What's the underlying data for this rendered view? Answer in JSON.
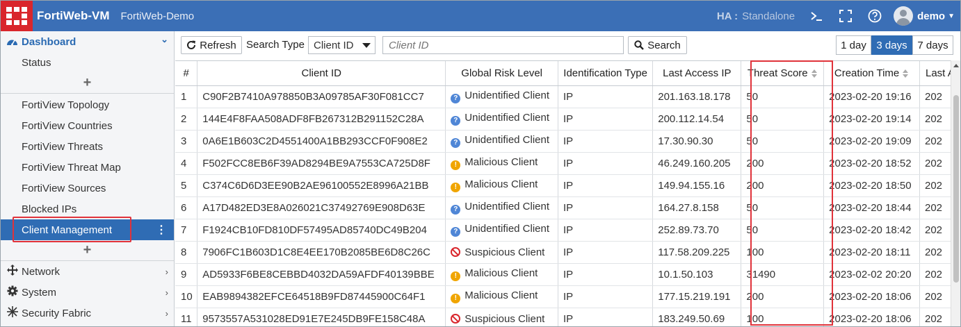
{
  "header": {
    "product": "FortiWeb-VM",
    "device": "FortiWeb-Demo",
    "ha_label": "HA :",
    "ha_value": "Standalone",
    "user": "demo",
    "colors": {
      "bar": "#3b6fb6",
      "logo": "#d9262c"
    }
  },
  "sidebar": {
    "dashboard_label": "Dashboard",
    "items_top": [
      "Status"
    ],
    "items_fortiview": [
      "FortiView Topology",
      "FortiView Countries",
      "FortiView Threats",
      "FortiView Threat Map",
      "FortiView Sources",
      "Blocked IPs",
      "Client Management"
    ],
    "active_item": "Client Management",
    "plus": "+",
    "kebab": "⋮",
    "chevron_down": "⌄",
    "chevron_right": "›",
    "groups": [
      "Network",
      "System",
      "Security Fabric"
    ]
  },
  "toolbar": {
    "refresh": "Refresh",
    "search_type_label": "Search Type :",
    "search_type_value": "Client ID",
    "search_placeholder": "Client ID",
    "search_button": "Search",
    "ranges": [
      "1 day",
      "3 days",
      "7 days"
    ],
    "selected_range": "3 days"
  },
  "table": {
    "columns": [
      "#",
      "Client ID",
      "Global Risk Level",
      "Identification Type",
      "Last Access IP",
      "Threat Score",
      "Creation Time",
      "Last A"
    ],
    "rows": [
      [
        "1",
        "C90F2B7410A978850B3A09785AF30F081CC7",
        "Unidentified Client",
        "IP",
        "201.163.18.178",
        "50",
        "2023-02-20 19:16",
        "202"
      ],
      [
        "2",
        "144E4F8FAA508ADF8FB267312B291152C28A",
        "Unidentified Client",
        "IP",
        "200.112.14.54",
        "50",
        "2023-02-20 19:14",
        "202"
      ],
      [
        "3",
        "0A6E1B603C2D4551400A1BB293CCF0F908E2",
        "Unidentified Client",
        "IP",
        "17.30.90.30",
        "50",
        "2023-02-20 19:09",
        "202"
      ],
      [
        "4",
        "F502FCC8EB6F39AD8294BE9A7553CA725D8F",
        "Malicious Client",
        "IP",
        "46.249.160.205",
        "200",
        "2023-02-20 18:52",
        "202"
      ],
      [
        "5",
        "C374C6D6D3EE90B2AE96100552E8996A21BB",
        "Malicious Client",
        "IP",
        "149.94.155.16",
        "200",
        "2023-02-20 18:50",
        "202"
      ],
      [
        "6",
        "A17D482ED3E8A026021C37492769E908D63E",
        "Unidentified Client",
        "IP",
        "164.27.8.158",
        "50",
        "2023-02-20 18:44",
        "202"
      ],
      [
        "7",
        "F1924CB10FD810DF57495AD85740DC49B204",
        "Unidentified Client",
        "IP",
        "252.89.73.70",
        "50",
        "2023-02-20 18:42",
        "202"
      ],
      [
        "8",
        "7906FC1B603D1C8E4EE170B2085BE6D8C26C",
        "Suspicious Client",
        "IP",
        "117.58.209.225",
        "100",
        "2023-02-20 18:11",
        "202"
      ],
      [
        "9",
        "AD5933F6BE8CEBBD4032DA59AFDF40139BBE",
        "Malicious Client",
        "IP",
        "10.1.50.103",
        "31490",
        "2023-02-02 20:20",
        "202"
      ],
      [
        "10",
        "EAB9894382EFCE64518B9FD87445900C64F1",
        "Malicious Client",
        "IP",
        "177.15.219.191",
        "200",
        "2023-02-20 18:06",
        "202"
      ],
      [
        "11",
        "9573557A531028ED91E7E245DB9FE158C48A",
        "Suspicious Client",
        "IP",
        "183.249.50.69",
        "100",
        "2023-02-20 18:06",
        "202"
      ]
    ],
    "risk_icons": {
      "Unidentified Client": "question-icon",
      "Malicious Client": "warning-icon",
      "Suspicious Client": "prohibited-icon"
    }
  }
}
